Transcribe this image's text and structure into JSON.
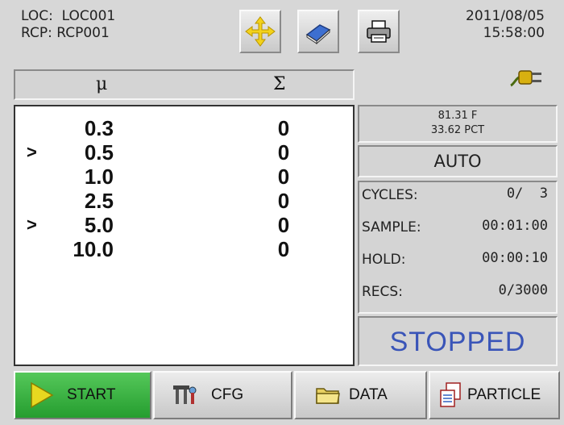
{
  "header": {
    "loc_label": "LOC:",
    "loc_value": "LOC001",
    "rcp_label": "RCP:",
    "rcp_value": "RCP001",
    "date": "2011/08/05",
    "time": "15:58:00"
  },
  "toolbar": {
    "move_icon": "move-arrows-icon",
    "book_icon": "book-icon",
    "print_icon": "printer-icon"
  },
  "power_icon": "power-plug-icon",
  "table": {
    "size_header": "μ",
    "count_header": "Σ",
    "rows": [
      {
        "marker": "",
        "size": "0.3",
        "count": "0"
      },
      {
        "marker": ">",
        "size": "0.5",
        "count": "0"
      },
      {
        "marker": "",
        "size": "1.0",
        "count": "0"
      },
      {
        "marker": "",
        "size": "2.5",
        "count": "0"
      },
      {
        "marker": ">",
        "size": "5.0",
        "count": "0"
      },
      {
        "marker": "",
        "size": "10.0",
        "count": "0"
      }
    ]
  },
  "environment": {
    "temperature": "81.31 F",
    "humidity": "33.62 PCT"
  },
  "mode": "AUTO",
  "stats": {
    "cycles_label": "CYCLES:",
    "cycles_value": "0/  3",
    "sample_label": "SAMPLE:",
    "sample_value": "00:01:00",
    "hold_label": "HOLD:",
    "hold_value": "00:00:10",
    "recs_label": "RECS:",
    "recs_value": "0/3000"
  },
  "status": "STOPPED",
  "nav": {
    "start_label": "START",
    "cfg_label": "CFG",
    "data_label": "DATA",
    "particle_label": "PARTICLE"
  },
  "colors": {
    "status_text": "#3a55b8",
    "start_button": "#3cb848",
    "background": "#d7d7d7"
  }
}
